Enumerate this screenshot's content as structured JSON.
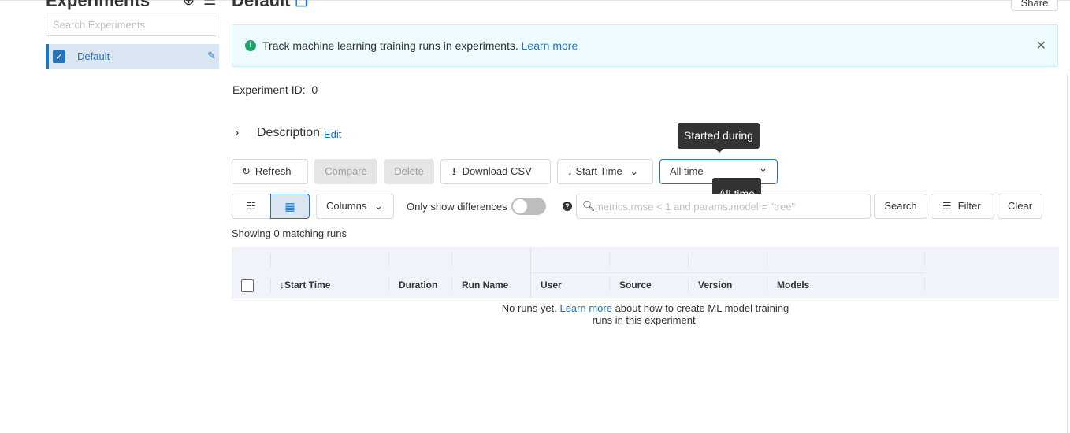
{
  "sidebar": {
    "title": "Experiments",
    "search_placeholder": "Search Experiments",
    "experiments": [
      {
        "name": "Default",
        "checked": true
      }
    ]
  },
  "header": {
    "title": "Default",
    "share_label": "Share"
  },
  "banner": {
    "text": "Track machine learning training runs in experiments.",
    "link": "Learn more"
  },
  "experiment": {
    "id_label": "Experiment ID:",
    "id_value": "0",
    "description_label": "Description",
    "description_edit": "Edit"
  },
  "toolbar": {
    "refresh": "Refresh",
    "compare": "Compare",
    "delete": "Delete",
    "download_csv": "Download CSV",
    "sort": "Start Time",
    "time_filter": "All time",
    "tooltip_started": "Started during",
    "tooltip_option": "All time"
  },
  "search_row": {
    "columns": "Columns",
    "only_diff": "Only show differences",
    "search_placeholder": "metrics.rmse < 1 and params.model = \"tree\"",
    "search_btn": "Search",
    "filter_btn": "Filter",
    "clear_btn": "Clear"
  },
  "runs": {
    "matching": "Showing 0 matching runs",
    "columns": [
      "Start Time",
      "Duration",
      "Run Name",
      "User",
      "Source",
      "Version",
      "Models"
    ],
    "empty_pre": "No runs yet.",
    "empty_link": "Learn more",
    "empty_post1": "about how to create ML model training",
    "empty_post2": "runs in this experiment."
  },
  "colors": {
    "accent": "#2374bb",
    "banner_bg": "#edfafe",
    "info_green": "#1aa567"
  }
}
